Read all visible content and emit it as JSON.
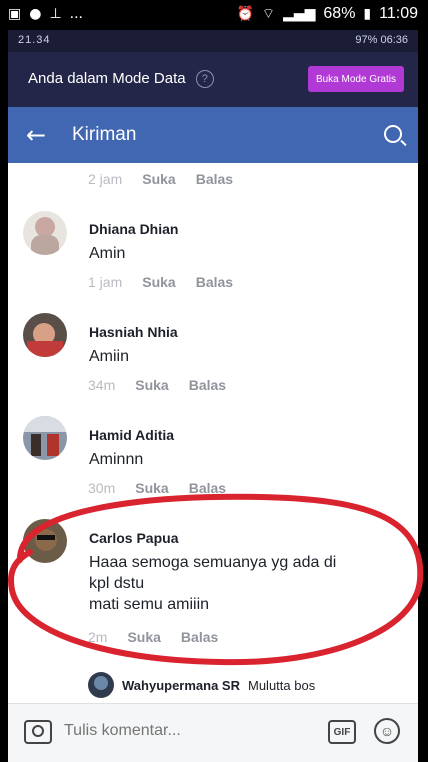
{
  "outer_status": {
    "left_icons": [
      "gallery-icon",
      "messenger-icon",
      "notification-icon",
      "more-icon"
    ],
    "more": "...",
    "battery": "68%",
    "time": "11:09"
  },
  "inner_status": {
    "time": "21.34",
    "right": "97% 06:36"
  },
  "mode_bar": {
    "text": "Anda dalam Mode Data",
    "help": "?",
    "button": "Buka Mode Gratis",
    "button_color": "#b13ad6"
  },
  "appbar": {
    "title": "Kiriman",
    "color": "#4267b2"
  },
  "comments": [
    {
      "name": "",
      "text": "",
      "time": "2 jam",
      "like": "Suka",
      "reply": "Balas"
    },
    {
      "name": "Dhiana Dhian",
      "text": "Amin",
      "time": "1 jam",
      "like": "Suka",
      "reply": "Balas"
    },
    {
      "name": "Hasniah Nhia",
      "text": "Amiin",
      "time": "34m",
      "like": "Suka",
      "reply": "Balas"
    },
    {
      "name": "Hamid Aditia",
      "text": "Aminnn",
      "time": "30m",
      "like": "Suka",
      "reply": "Balas"
    },
    {
      "name": "Carlos Papua",
      "text_lines": [
        "Haaa semoga semuanya yg ada di",
        "kpl dstu",
        "mati semu amiiin"
      ],
      "time": "2m",
      "like": "Suka",
      "reply": "Balas"
    }
  ],
  "reply_preview": {
    "name": "Wahyupermana SR",
    "text": "Mulutta bos"
  },
  "composer": {
    "placeholder": "Tulis komentar...",
    "gif": "GIF"
  },
  "highlight_color": "#d9232e"
}
